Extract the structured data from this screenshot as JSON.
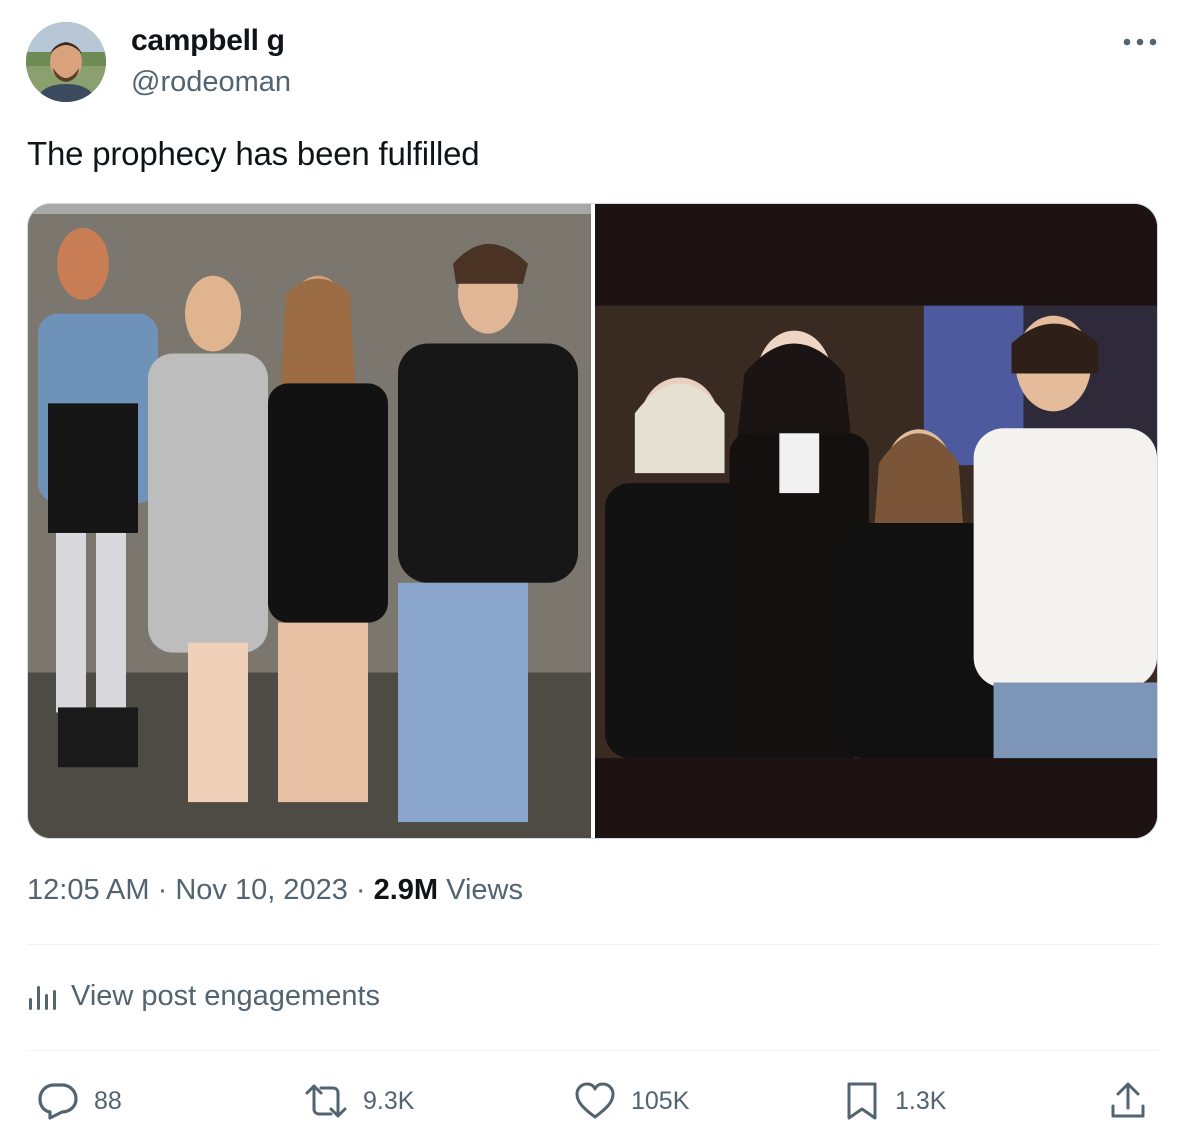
{
  "author": {
    "display_name": "campbell g",
    "handle": "@rodeoman",
    "avatar_icon": "profile-photo"
  },
  "tweet": {
    "text": "The prophecy has been fulfilled"
  },
  "meta": {
    "time": "12:05 AM",
    "separator": "·",
    "date": "Nov 10, 2023",
    "views_count": "2.9M",
    "views_label": "Views"
  },
  "engagements": {
    "label": "View post engagements",
    "icon": "analytics-icon"
  },
  "actions": {
    "reply_count": "88",
    "repost_count": "9.3K",
    "like_count": "105K",
    "bookmark_count": "1.3K"
  },
  "colors": {
    "text_primary": "#0f1419",
    "text_secondary": "#536471",
    "divider": "#eff3f4"
  }
}
